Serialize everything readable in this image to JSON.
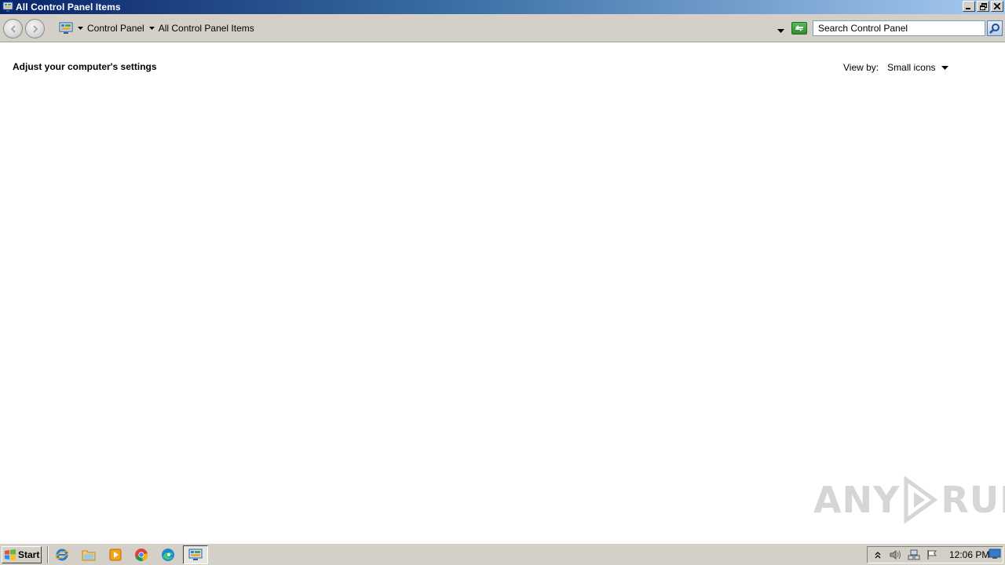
{
  "window": {
    "title": "All Control Panel Items",
    "minimize_icon": "minimize-icon",
    "restore_icon": "restore-icon",
    "close_icon": "close-icon"
  },
  "navigation": {
    "back_icon": "back-arrow-icon",
    "forward_icon": "forward-arrow-icon",
    "breadcrumb": [
      "Control Panel",
      "All Control Panel Items"
    ],
    "refresh_icon": "refresh-icon"
  },
  "search": {
    "placeholder": "Search Control Panel",
    "icon": "search-icon"
  },
  "main": {
    "heading": "Adjust your computer's settings",
    "view_by_label": "View by:",
    "view_by_value": "Small icons"
  },
  "watermark": {
    "left": "ANY",
    "right": "RUN"
  },
  "taskbar": {
    "start_label": "Start",
    "pinned": [
      "internet-explorer-icon",
      "file-explorer-icon",
      "media-player-icon",
      "chrome-icon",
      "edge-icon"
    ],
    "active": "control-panel-icon",
    "tray": [
      "show-hidden-icons-icon",
      "volume-icon",
      "network-icon",
      "action-center-flag-icon"
    ],
    "clock": "12:06 PM"
  },
  "colors": {
    "titlebar_start": "#0a246a",
    "titlebar_end": "#a6caf0",
    "chrome": "#d4d0c8",
    "content_bg": "#ffffff"
  }
}
